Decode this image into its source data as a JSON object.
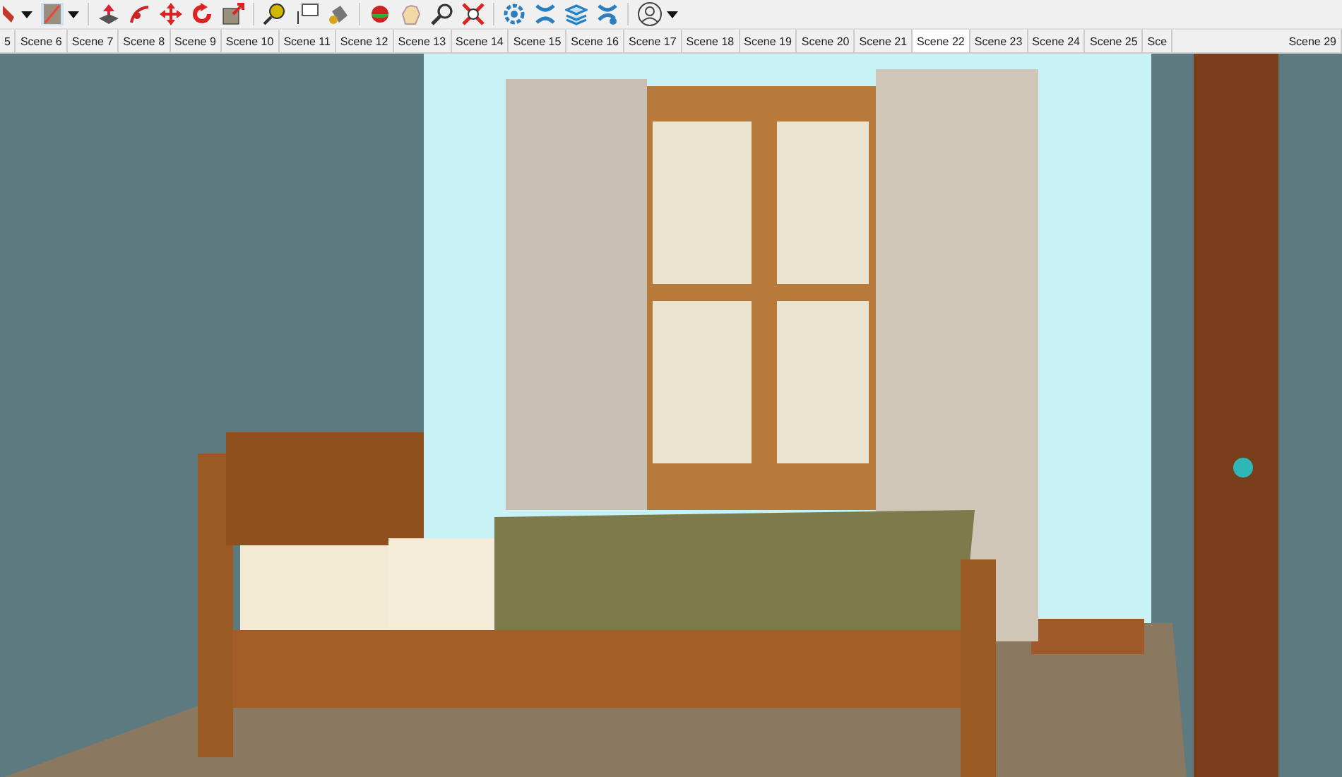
{
  "scene_tabs": [
    {
      "label": "5",
      "selected": false
    },
    {
      "label": "Scene 6",
      "selected": false
    },
    {
      "label": "Scene 7",
      "selected": false
    },
    {
      "label": "Scene 8",
      "selected": false
    },
    {
      "label": "Scene 9",
      "selected": false
    },
    {
      "label": "Scene 10",
      "selected": false
    },
    {
      "label": "Scene 11",
      "selected": false
    },
    {
      "label": "Scene 12",
      "selected": false
    },
    {
      "label": "Scene 13",
      "selected": false
    },
    {
      "label": "Scene 14",
      "selected": false
    },
    {
      "label": "Scene 15",
      "selected": false
    },
    {
      "label": "Scene 16",
      "selected": false
    },
    {
      "label": "Scene 17",
      "selected": false
    },
    {
      "label": "Scene 18",
      "selected": false
    },
    {
      "label": "Scene 19",
      "selected": false
    },
    {
      "label": "Scene 20",
      "selected": false
    },
    {
      "label": "Scene 21",
      "selected": false
    },
    {
      "label": "Scene 22",
      "selected": true
    },
    {
      "label": "Scene 23",
      "selected": false
    },
    {
      "label": "Scene 24",
      "selected": false
    },
    {
      "label": "Scene 25",
      "selected": false
    },
    {
      "label": "Sce",
      "selected": false
    },
    {
      "label": "Scene 29",
      "selected": false
    }
  ]
}
